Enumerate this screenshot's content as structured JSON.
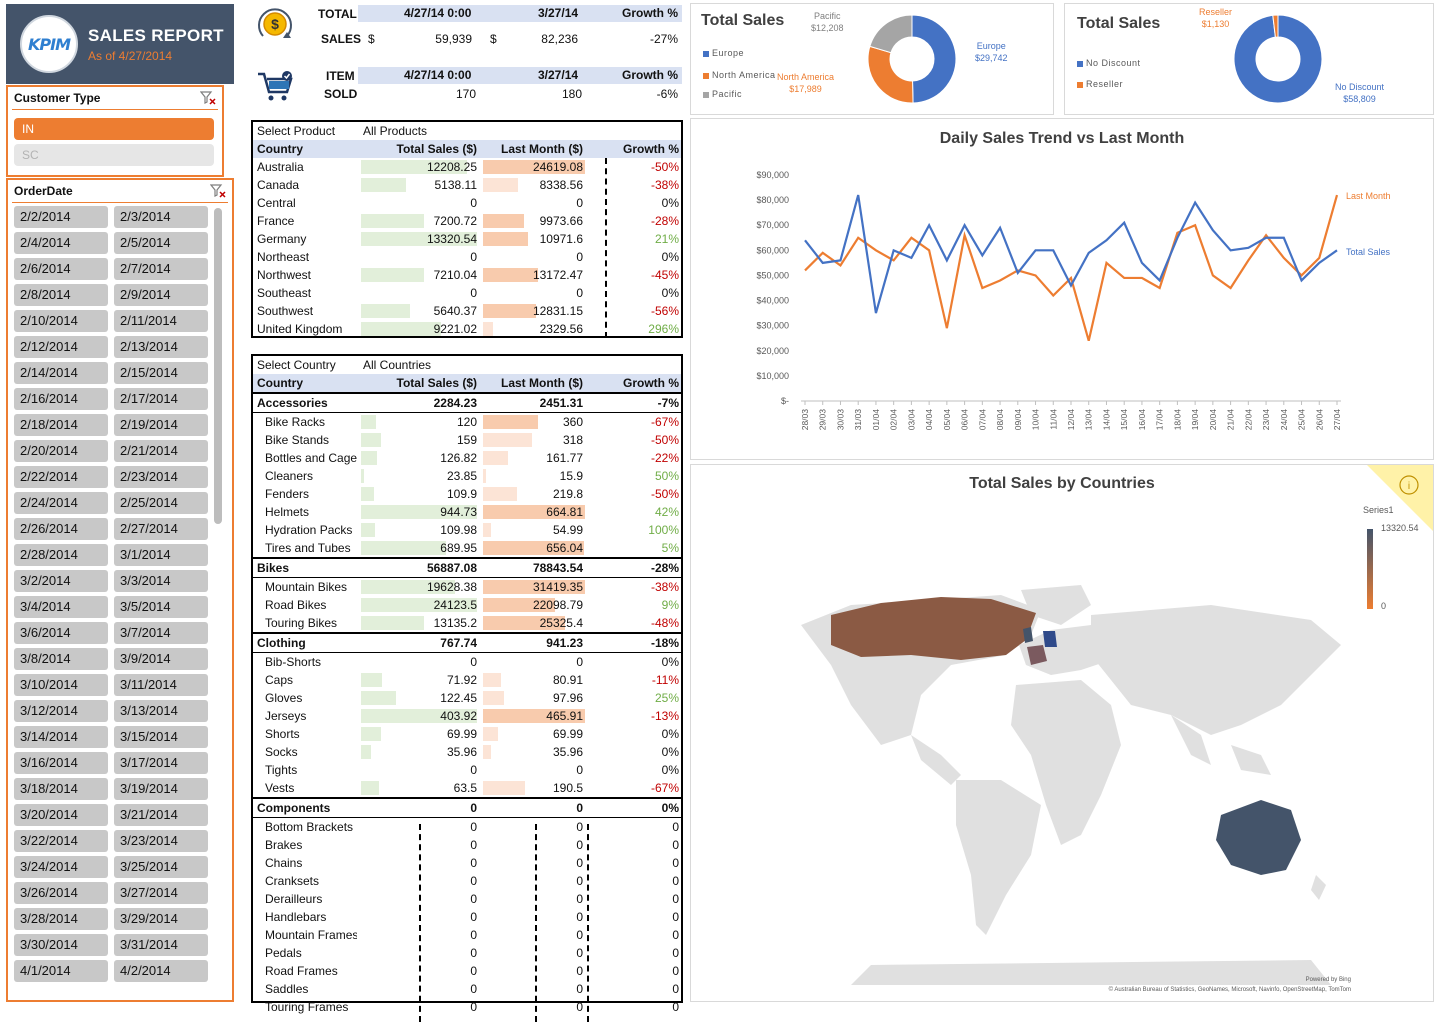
{
  "header": {
    "logo_text": "KPIM",
    "title": "SALES REPORT",
    "as_of": "As of 4/27/2014"
  },
  "customer_type": {
    "label": "Customer Type",
    "items": [
      "IN",
      "SC"
    ],
    "selected": "IN"
  },
  "order_date": {
    "label": "OrderDate",
    "items": [
      "2/2/2014",
      "2/3/2014",
      "2/4/2014",
      "2/5/2014",
      "2/6/2014",
      "2/7/2014",
      "2/8/2014",
      "2/9/2014",
      "2/10/2014",
      "2/11/2014",
      "2/12/2014",
      "2/13/2014",
      "2/14/2014",
      "2/15/2014",
      "2/16/2014",
      "2/17/2014",
      "2/18/2014",
      "2/19/2014",
      "2/20/2014",
      "2/21/2014",
      "2/22/2014",
      "2/23/2014",
      "2/24/2014",
      "2/25/2014",
      "2/26/2014",
      "2/27/2014",
      "2/28/2014",
      "3/1/2014",
      "3/2/2014",
      "3/3/2014",
      "3/4/2014",
      "3/5/2014",
      "3/6/2014",
      "3/7/2014",
      "3/8/2014",
      "3/9/2014",
      "3/10/2014",
      "3/11/2014",
      "3/12/2014",
      "3/13/2014",
      "3/14/2014",
      "3/15/2014",
      "3/16/2014",
      "3/17/2014",
      "3/18/2014",
      "3/19/2014",
      "3/20/2014",
      "3/21/2014",
      "3/22/2014",
      "3/23/2014",
      "3/24/2014",
      "3/25/2014",
      "3/26/2014",
      "3/27/2014",
      "3/28/2014",
      "3/29/2014",
      "3/30/2014",
      "3/31/2014",
      "4/1/2014",
      "4/2/2014"
    ]
  },
  "kpi_sales": {
    "label1": "TOTAL",
    "label2": "SALES",
    "col_current": "4/27/14 0:00",
    "col_prev": "3/27/14",
    "col_growth": "Growth %",
    "cur_sym": "$",
    "cur": "59,939",
    "prev_sym": "$",
    "prev": "82,236",
    "growth": "-27%"
  },
  "kpi_items": {
    "label1": "ITEM",
    "label2": "SOLD",
    "col_current": "4/27/14 0:00",
    "col_prev": "3/27/14",
    "col_growth": "Growth %",
    "cur": "170",
    "prev": "180",
    "growth": "-6%"
  },
  "country_table": {
    "filter_label": "Select Product",
    "filter_value": "All Products",
    "headers": [
      "Country",
      "Total Sales ($)",
      "Last Month ($)",
      "Growth %"
    ],
    "rows": [
      {
        "name": "Australia",
        "total": "12208.25",
        "last": "24619.08",
        "growth": "-50%"
      },
      {
        "name": "Canada",
        "total": "5138.11",
        "last": "8338.56",
        "growth": "-38%"
      },
      {
        "name": "Central",
        "total": "0",
        "last": "0",
        "growth": "0%"
      },
      {
        "name": "France",
        "total": "7200.72",
        "last": "9973.66",
        "growth": "-28%"
      },
      {
        "name": "Germany",
        "total": "13320.54",
        "last": "10971.6",
        "growth": "21%"
      },
      {
        "name": "Northeast",
        "total": "0",
        "last": "0",
        "growth": "0%"
      },
      {
        "name": "Northwest",
        "total": "7210.04",
        "last": "13172.47",
        "growth": "-45%"
      },
      {
        "name": "Southeast",
        "total": "0",
        "last": "0",
        "growth": "0%"
      },
      {
        "name": "Southwest",
        "total": "5640.37",
        "last": "12831.15",
        "growth": "-56%"
      },
      {
        "name": "United Kingdom",
        "total": "9221.02",
        "last": "2329.56",
        "growth": "296%"
      }
    ]
  },
  "product_table": {
    "filter_label": "Select Country",
    "filter_value": "All Countries",
    "headers": [
      "Country",
      "Total Sales ($)",
      "Last Month ($)",
      "Growth %"
    ],
    "rows": [
      {
        "name": "Accessories",
        "total": "2284.23",
        "last": "2451.31",
        "growth": "-7%",
        "group": true
      },
      {
        "name": "Bike Racks",
        "total": "120",
        "last": "360",
        "growth": "-67%"
      },
      {
        "name": "Bike Stands",
        "total": "159",
        "last": "318",
        "growth": "-50%"
      },
      {
        "name": "Bottles and Cages",
        "total": "126.82",
        "last": "161.77",
        "growth": "-22%"
      },
      {
        "name": "Cleaners",
        "total": "23.85",
        "last": "15.9",
        "growth": "50%"
      },
      {
        "name": "Fenders",
        "total": "109.9",
        "last": "219.8",
        "growth": "-50%"
      },
      {
        "name": "Helmets",
        "total": "944.73",
        "last": "664.81",
        "growth": "42%"
      },
      {
        "name": "Hydration Packs",
        "total": "109.98",
        "last": "54.99",
        "growth": "100%"
      },
      {
        "name": "Tires and Tubes",
        "total": "689.95",
        "last": "656.04",
        "growth": "5%"
      },
      {
        "name": "Bikes",
        "total": "56887.08",
        "last": "78843.54",
        "growth": "-28%",
        "group": true
      },
      {
        "name": "Mountain Bikes",
        "total": "19628.38",
        "last": "31419.35",
        "growth": "-38%"
      },
      {
        "name": "Road Bikes",
        "total": "24123.5",
        "last": "22098.79",
        "growth": "9%"
      },
      {
        "name": "Touring Bikes",
        "total": "13135.2",
        "last": "25325.4",
        "growth": "-48%"
      },
      {
        "name": "Clothing",
        "total": "767.74",
        "last": "941.23",
        "growth": "-18%",
        "group": true
      },
      {
        "name": "Bib-Shorts",
        "total": "0",
        "last": "0",
        "growth": "0%"
      },
      {
        "name": "Caps",
        "total": "71.92",
        "last": "80.91",
        "growth": "-11%"
      },
      {
        "name": "Gloves",
        "total": "122.45",
        "last": "97.96",
        "growth": "25%"
      },
      {
        "name": "Jerseys",
        "total": "403.92",
        "last": "465.91",
        "growth": "-13%"
      },
      {
        "name": "Shorts",
        "total": "69.99",
        "last": "69.99",
        "growth": "0%"
      },
      {
        "name": "Socks",
        "total": "35.96",
        "last": "35.96",
        "growth": "0%"
      },
      {
        "name": "Tights",
        "total": "0",
        "last": "0",
        "growth": "0%"
      },
      {
        "name": "Vests",
        "total": "63.5",
        "last": "190.5",
        "growth": "-67%"
      },
      {
        "name": "Components",
        "total": "0",
        "last": "0",
        "growth": "0%",
        "group": true
      },
      {
        "name": "Bottom Brackets",
        "total": "0",
        "last": "0",
        "growth": "0"
      },
      {
        "name": "Brakes",
        "total": "0",
        "last": "0",
        "growth": "0"
      },
      {
        "name": "Chains",
        "total": "0",
        "last": "0",
        "growth": "0"
      },
      {
        "name": "Cranksets",
        "total": "0",
        "last": "0",
        "growth": "0"
      },
      {
        "name": "Derailleurs",
        "total": "0",
        "last": "0",
        "growth": "0"
      },
      {
        "name": "Handlebars",
        "total": "0",
        "last": "0",
        "growth": "0"
      },
      {
        "name": "Mountain Frames",
        "total": "0",
        "last": "0",
        "growth": "0"
      },
      {
        "name": "Pedals",
        "total": "0",
        "last": "0",
        "growth": "0"
      },
      {
        "name": "Road Frames",
        "total": "0",
        "last": "0",
        "growth": "0"
      },
      {
        "name": "Saddles",
        "total": "0",
        "last": "0",
        "growth": "0"
      },
      {
        "name": "Touring Frames",
        "total": "0",
        "last": "0",
        "growth": "0"
      }
    ]
  },
  "donut_region": {
    "title": "Total Sales",
    "legend": [
      "Europe",
      "North America",
      "Pacific"
    ],
    "labels": {
      "europe_name": "Europe",
      "europe_val": "$29,742",
      "na_name": "North America",
      "na_val": "$17,989",
      "pacific_name": "Pacific",
      "pacific_val": "$12,208"
    }
  },
  "donut_discount": {
    "title": "Total Sales",
    "legend": [
      "No Discount",
      "Reseller"
    ],
    "labels": {
      "nd_name": "No Discount",
      "nd_val": "$58,809",
      "res_name": "Reseller",
      "res_val": "$1,130"
    }
  },
  "trend_chart": {
    "title": "Daily Sales Trend vs Last Month",
    "y_ticks": [
      "$90,000",
      "$80,000",
      "$70,000",
      "$60,000",
      "$50,000",
      "$40,000",
      "$30,000",
      "$20,000",
      "$10,000",
      "$-"
    ],
    "label_last": "Last Month",
    "label_total": "Total Sales"
  },
  "map_panel": {
    "title": "Total Sales by Countries",
    "legend_series": "Series1",
    "legend_max": "13320.54",
    "legend_min": "0",
    "powered": "Powered by Bing",
    "credits": "© Australian Bureau of Statistics, GeoNames, Microsoft, Navinfo, OpenStreetMap, TomTom"
  },
  "colors": {
    "accent": "#ed7d31",
    "blue": "#4472c4",
    "gray": "#a5a5a5",
    "header_bg": "#44546a"
  },
  "chart_data": [
    {
      "type": "pie",
      "title": "Total Sales",
      "categories": [
        "Europe",
        "North America",
        "Pacific"
      ],
      "values": [
        29742,
        17989,
        12208
      ]
    },
    {
      "type": "pie",
      "title": "Total Sales",
      "categories": [
        "No Discount",
        "Reseller"
      ],
      "values": [
        58809,
        1130
      ]
    },
    {
      "type": "line",
      "title": "Daily Sales Trend vs Last Month",
      "x": [
        "28/03",
        "29/03",
        "30/03",
        "31/03",
        "01/04",
        "02/04",
        "03/04",
        "04/04",
        "05/04",
        "06/04",
        "07/04",
        "08/04",
        "09/04",
        "10/04",
        "11/04",
        "12/04",
        "13/04",
        "14/04",
        "15/04",
        "16/04",
        "17/04",
        "18/04",
        "19/04",
        "20/04",
        "21/04",
        "22/04",
        "23/04",
        "24/04",
        "25/04",
        "26/04",
        "27/04"
      ],
      "ylim": [
        0,
        90000
      ],
      "series": [
        {
          "name": "Total Sales",
          "values": [
            64000,
            55000,
            56000,
            82000,
            35000,
            60000,
            57000,
            70000,
            56000,
            70000,
            58000,
            69000,
            51000,
            60000,
            60000,
            46000,
            59000,
            64000,
            71000,
            55000,
            48000,
            65000,
            79000,
            68000,
            60000,
            61000,
            65000,
            65000,
            48000,
            55000,
            60000
          ]
        },
        {
          "name": "Last Month",
          "values": [
            52000,
            59000,
            54000,
            65000,
            60000,
            56000,
            65000,
            60000,
            29000,
            66000,
            45000,
            48000,
            52000,
            50000,
            42000,
            49000,
            24000,
            55000,
            49000,
            49000,
            45000,
            67000,
            70000,
            50000,
            45000,
            56000,
            66000,
            57000,
            50000,
            57000,
            82000
          ]
        }
      ]
    },
    {
      "type": "heatmap",
      "title": "Total Sales by Countries",
      "categories": [
        "Australia",
        "Canada",
        "France",
        "Germany",
        "United Kingdom"
      ],
      "values": [
        12208.25,
        5138.11,
        7200.72,
        13320.54,
        9221.02
      ],
      "legend_range": [
        0,
        13320.54
      ]
    }
  ]
}
